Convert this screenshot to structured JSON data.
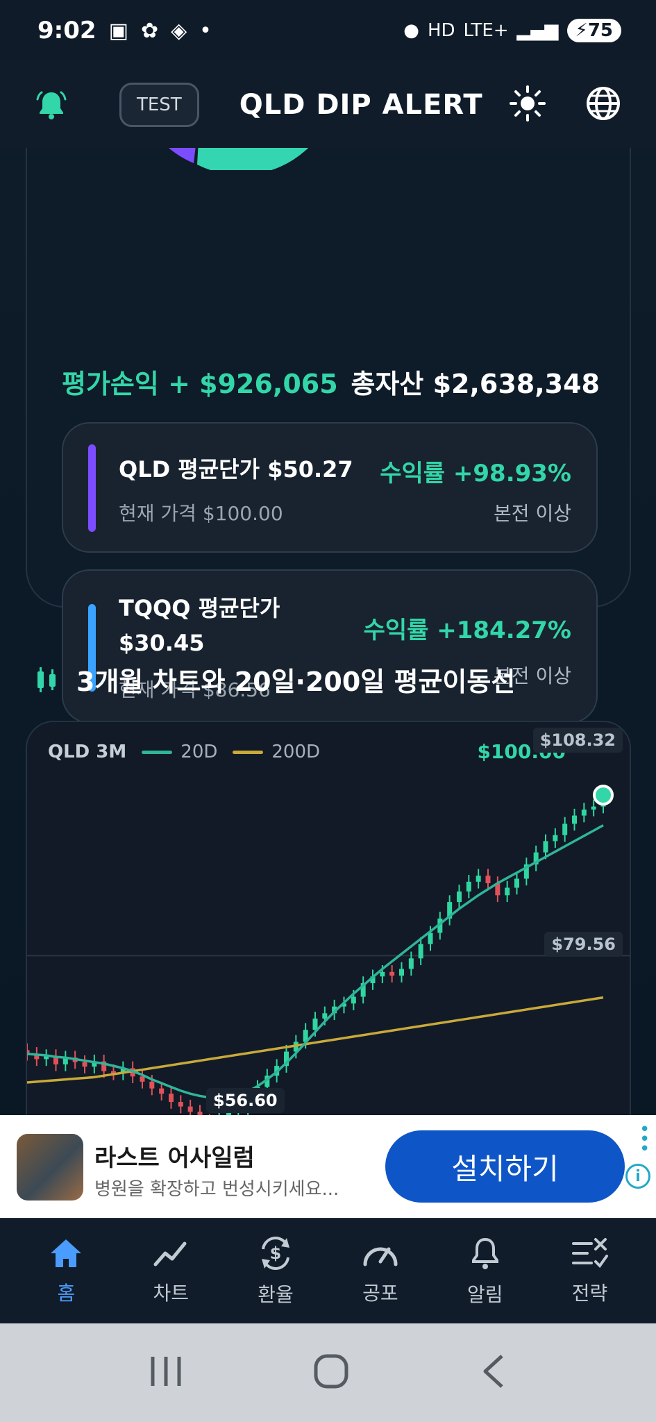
{
  "status_bar": {
    "time": "9:02",
    "network": "LTE+",
    "battery": "75"
  },
  "header": {
    "test_label": "TEST",
    "title": "QLD DIP ALERT"
  },
  "summary": {
    "pnl": "평가손익 + $926,065",
    "total_assets": "총자산 $2,638,348",
    "holdings": [
      {
        "name": "QLD 평균단가 $50.27",
        "current": "현재 가격 $100.00",
        "return": "수익률 +98.93%",
        "note": "본전 이상",
        "color": "#7b4dff"
      },
      {
        "name_line1": "TQQQ 평균단가",
        "name_line2": "$30.45",
        "current": "현재 가격 $86.56",
        "return": "수익률 +184.27%",
        "note": "본전 이상",
        "color": "#3aa3ff"
      }
    ]
  },
  "section": {
    "title": "3개월 차트와 20일·200일 평균이동선"
  },
  "chart_data": {
    "type": "line",
    "symbol": "QLD 3M",
    "legend": [
      "20D",
      "200D"
    ],
    "current_price": "$100.00",
    "labels": {
      "high": "$108.32",
      "mid": "$79.56",
      "low": "$56.60"
    },
    "ylim": [
      56.6,
      108.32
    ],
    "close": [
      66.5,
      65.8,
      66.2,
      65.1,
      66.0,
      65.4,
      64.8,
      65.5,
      64.2,
      63.9,
      64.6,
      63.5,
      62.8,
      61.9,
      61.2,
      60.1,
      59.5,
      58.8,
      57.6,
      56.9,
      57.9,
      58.7,
      59.2,
      60.8,
      62.1,
      63.6,
      64.9,
      66.8,
      68.1,
      69.7,
      71.2,
      71.9,
      72.8,
      73.2,
      74.1,
      75.9,
      76.8,
      77.4,
      76.9,
      77.8,
      79.2,
      81.1,
      82.6,
      84.5,
      86.7,
      88.1,
      89.4,
      90.2,
      89.2,
      87.6,
      88.6,
      89.8,
      91.7,
      93.3,
      94.8,
      95.6,
      97.1,
      98.2,
      99.0,
      99.4,
      100.0
    ],
    "ma20": [
      66.5,
      66.4,
      66.3,
      66.1,
      66.0,
      65.8,
      65.6,
      65.4,
      65.2,
      64.9,
      64.6,
      64.2,
      63.7,
      63.1,
      62.6,
      62.1,
      61.6,
      61.2,
      60.9,
      60.7,
      60.6,
      60.7,
      61.0,
      61.5,
      62.2,
      63.1,
      64.1,
      65.3,
      66.6,
      68.0,
      69.4,
      70.8,
      72.1,
      73.3,
      74.5,
      75.6,
      76.7,
      77.8,
      78.8,
      79.8,
      80.8,
      81.8,
      82.8,
      83.8,
      84.8,
      85.8,
      86.7,
      87.6,
      88.4,
      89.2,
      89.9,
      90.6,
      91.3,
      92.0,
      92.7,
      93.4,
      94.1,
      94.8,
      95.5,
      96.2,
      96.9
    ],
    "ma200": [
      62.7,
      62.8,
      62.9,
      63.0,
      63.1,
      63.2,
      63.3,
      63.4,
      63.6,
      63.8,
      64.0,
      64.2,
      64.4,
      64.6,
      64.8,
      65.0,
      65.2,
      65.4,
      65.6,
      65.8,
      66.0,
      66.2,
      66.4,
      66.6,
      66.8,
      67.0,
      67.2,
      67.4,
      67.6,
      67.8,
      68.0,
      68.2,
      68.4,
      68.6,
      68.8,
      69.0,
      69.2,
      69.4,
      69.6,
      69.8,
      70.0,
      70.2,
      70.4,
      70.6,
      70.8,
      71.0,
      71.2,
      71.4,
      71.6,
      71.8,
      72.0,
      72.2,
      72.4,
      72.6,
      72.8,
      73.0,
      73.2,
      73.4,
      73.6,
      73.8,
      74.0
    ]
  },
  "ad": {
    "title": "라스트 어사일럼",
    "description": "병원을 확장하고 번성시키세요...",
    "button": "설치하기"
  },
  "bottom_nav": {
    "items": [
      {
        "label": "홈",
        "icon": "home-icon",
        "active": true
      },
      {
        "label": "차트",
        "icon": "chart-line-icon",
        "active": false
      },
      {
        "label": "환율",
        "icon": "currency-exchange-icon",
        "active": false
      },
      {
        "label": "공포",
        "icon": "gauge-icon",
        "active": false
      },
      {
        "label": "알림",
        "icon": "bell-icon",
        "active": false
      },
      {
        "label": "전략",
        "icon": "strategy-icon",
        "active": false
      }
    ]
  },
  "colors": {
    "accent_green": "#33d6a8",
    "accent_blue": "#4a9dff",
    "ma20": "#2fb59a",
    "ma200": "#c9a93a",
    "candle_up": "#2fd6a0",
    "candle_down": "#e0525a"
  }
}
